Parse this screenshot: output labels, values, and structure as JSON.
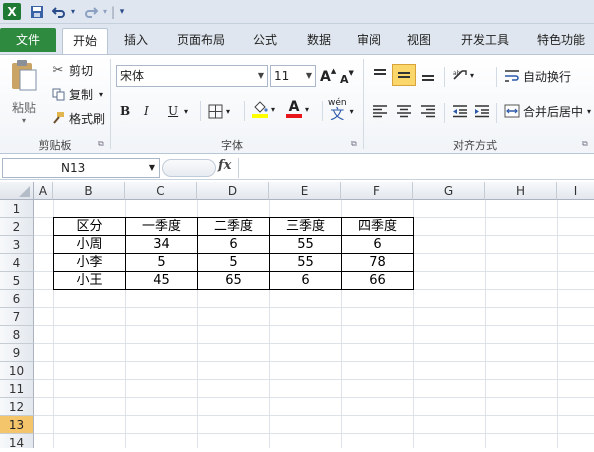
{
  "quick_access": {
    "separator": "|",
    "dropdown": "▾"
  },
  "tabs": [
    "文件",
    "开始",
    "插入",
    "页面布局",
    "公式",
    "数据",
    "审阅",
    "视图",
    "开发工具",
    "特色功能"
  ],
  "ribbon": {
    "clipboard": {
      "paste": "粘贴",
      "cut": "剪切",
      "copy": "复制",
      "format_painter": "格式刷",
      "group_label": "剪贴板"
    },
    "font": {
      "font_name": "宋体",
      "font_size": "11",
      "bold": "B",
      "italic": "I",
      "underline": "U",
      "grow": "A",
      "shrink": "A",
      "font_color_glyph": "A",
      "wen": "wén",
      "wen_char": "文",
      "group_label": "字体"
    },
    "alignment": {
      "wrap_text": "自动换行",
      "merge_center": "合并后居中",
      "group_label": "对齐方式"
    }
  },
  "formula_bar": {
    "name_box": "N13",
    "fx": "fx",
    "formula": ""
  },
  "sheet": {
    "columns": [
      "A",
      "B",
      "C",
      "D",
      "E",
      "F",
      "G",
      "H",
      "I"
    ],
    "rows": [
      "1",
      "2",
      "3",
      "4",
      "5",
      "6",
      "7",
      "8",
      "9",
      "10",
      "11",
      "12",
      "13",
      "14"
    ],
    "selected_row": "13",
    "table": {
      "header": [
        "区分",
        "一季度",
        "二季度",
        "三季度",
        "四季度"
      ],
      "data": [
        [
          "小周",
          "34",
          "6",
          "55",
          "6"
        ],
        [
          "小李",
          "5",
          "5",
          "55",
          "78"
        ],
        [
          "小王",
          "45",
          "65",
          "6",
          "66"
        ]
      ]
    }
  },
  "colors": {
    "file_tab": "#2e8a3e",
    "selected_row_header": "#f5c56b",
    "active_align": "#fbd76b"
  }
}
